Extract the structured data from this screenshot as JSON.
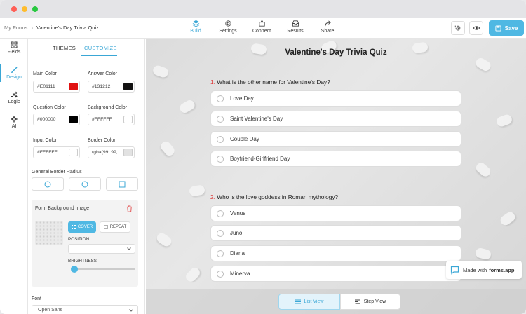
{
  "window": {
    "dots": [
      "#ff5f57",
      "#febc2e",
      "#28c840"
    ]
  },
  "breadcrumb": {
    "root": "My Forms",
    "separator": "›",
    "current": "Valentine's Day Trivia Quiz"
  },
  "topnav": [
    {
      "label": "Build",
      "icon": "layers-icon",
      "active": true
    },
    {
      "label": "Settings",
      "icon": "gear-icon",
      "active": false
    },
    {
      "label": "Connect",
      "icon": "puzzle-icon",
      "active": false
    },
    {
      "label": "Results",
      "icon": "inbox-icon",
      "active": false
    },
    {
      "label": "Share",
      "icon": "share-icon",
      "active": false
    }
  ],
  "actions": {
    "save_label": "Save",
    "history_icon": "history-icon",
    "preview_icon": "eye-icon"
  },
  "leftnav": [
    {
      "label": "Fields",
      "icon": "grid-icon",
      "active": false
    },
    {
      "label": "Design",
      "icon": "brush-icon",
      "active": true
    },
    {
      "label": "Logic",
      "icon": "shuffle-icon",
      "active": false
    },
    {
      "label": "AI",
      "icon": "sparkle-icon",
      "active": false
    }
  ],
  "panel": {
    "tabs": [
      "THEMES",
      "CUSTOMIZE"
    ],
    "active_tab": "CUSTOMIZE",
    "colors": [
      {
        "label": "Main Color",
        "value": "#E01111",
        "swatch": "#e01111"
      },
      {
        "label": "Answer Color",
        "value": "#131212",
        "swatch": "#131212"
      },
      {
        "label": "Question Color",
        "value": "#000000",
        "swatch": "#000000"
      },
      {
        "label": "Background Color",
        "value": "#FFFFFF",
        "swatch": "#ffffff"
      },
      {
        "label": "Input Color",
        "value": "#FFFFFF",
        "swatch": "#ffffff"
      },
      {
        "label": "Border Color",
        "value": "rgba(99, 99,",
        "swatch": "#e2e2e2"
      }
    ],
    "border_radius_label": "General Border Radius",
    "bg_image": {
      "label": "Form Background Image",
      "cover_label": "COVER",
      "repeat_label": "REPEAT",
      "position_label": "POSITION",
      "brightness_label": "BRIGHTNESS"
    },
    "font": {
      "label": "Font",
      "value": "Open Sans"
    }
  },
  "form": {
    "title": "Valentine's Day Trivia Quiz",
    "questions": [
      {
        "number": "1.",
        "text": "What is the other name for Valentine's Day?",
        "options": [
          "Love Day",
          "Saint Valentine's Day",
          "Couple Day",
          "Boyfriend-Girlfriend Day"
        ]
      },
      {
        "number": "2.",
        "text": "Who is the love goddess in Roman mythology?",
        "options": [
          "Venus",
          "Juno",
          "Diana",
          "Minerva"
        ]
      }
    ]
  },
  "viewbar": {
    "list_label": "List View",
    "step_label": "Step View",
    "active": "List View"
  },
  "badge": {
    "prefix": "Made with",
    "brand": "forms.app"
  },
  "accent": "#3aa7d6"
}
